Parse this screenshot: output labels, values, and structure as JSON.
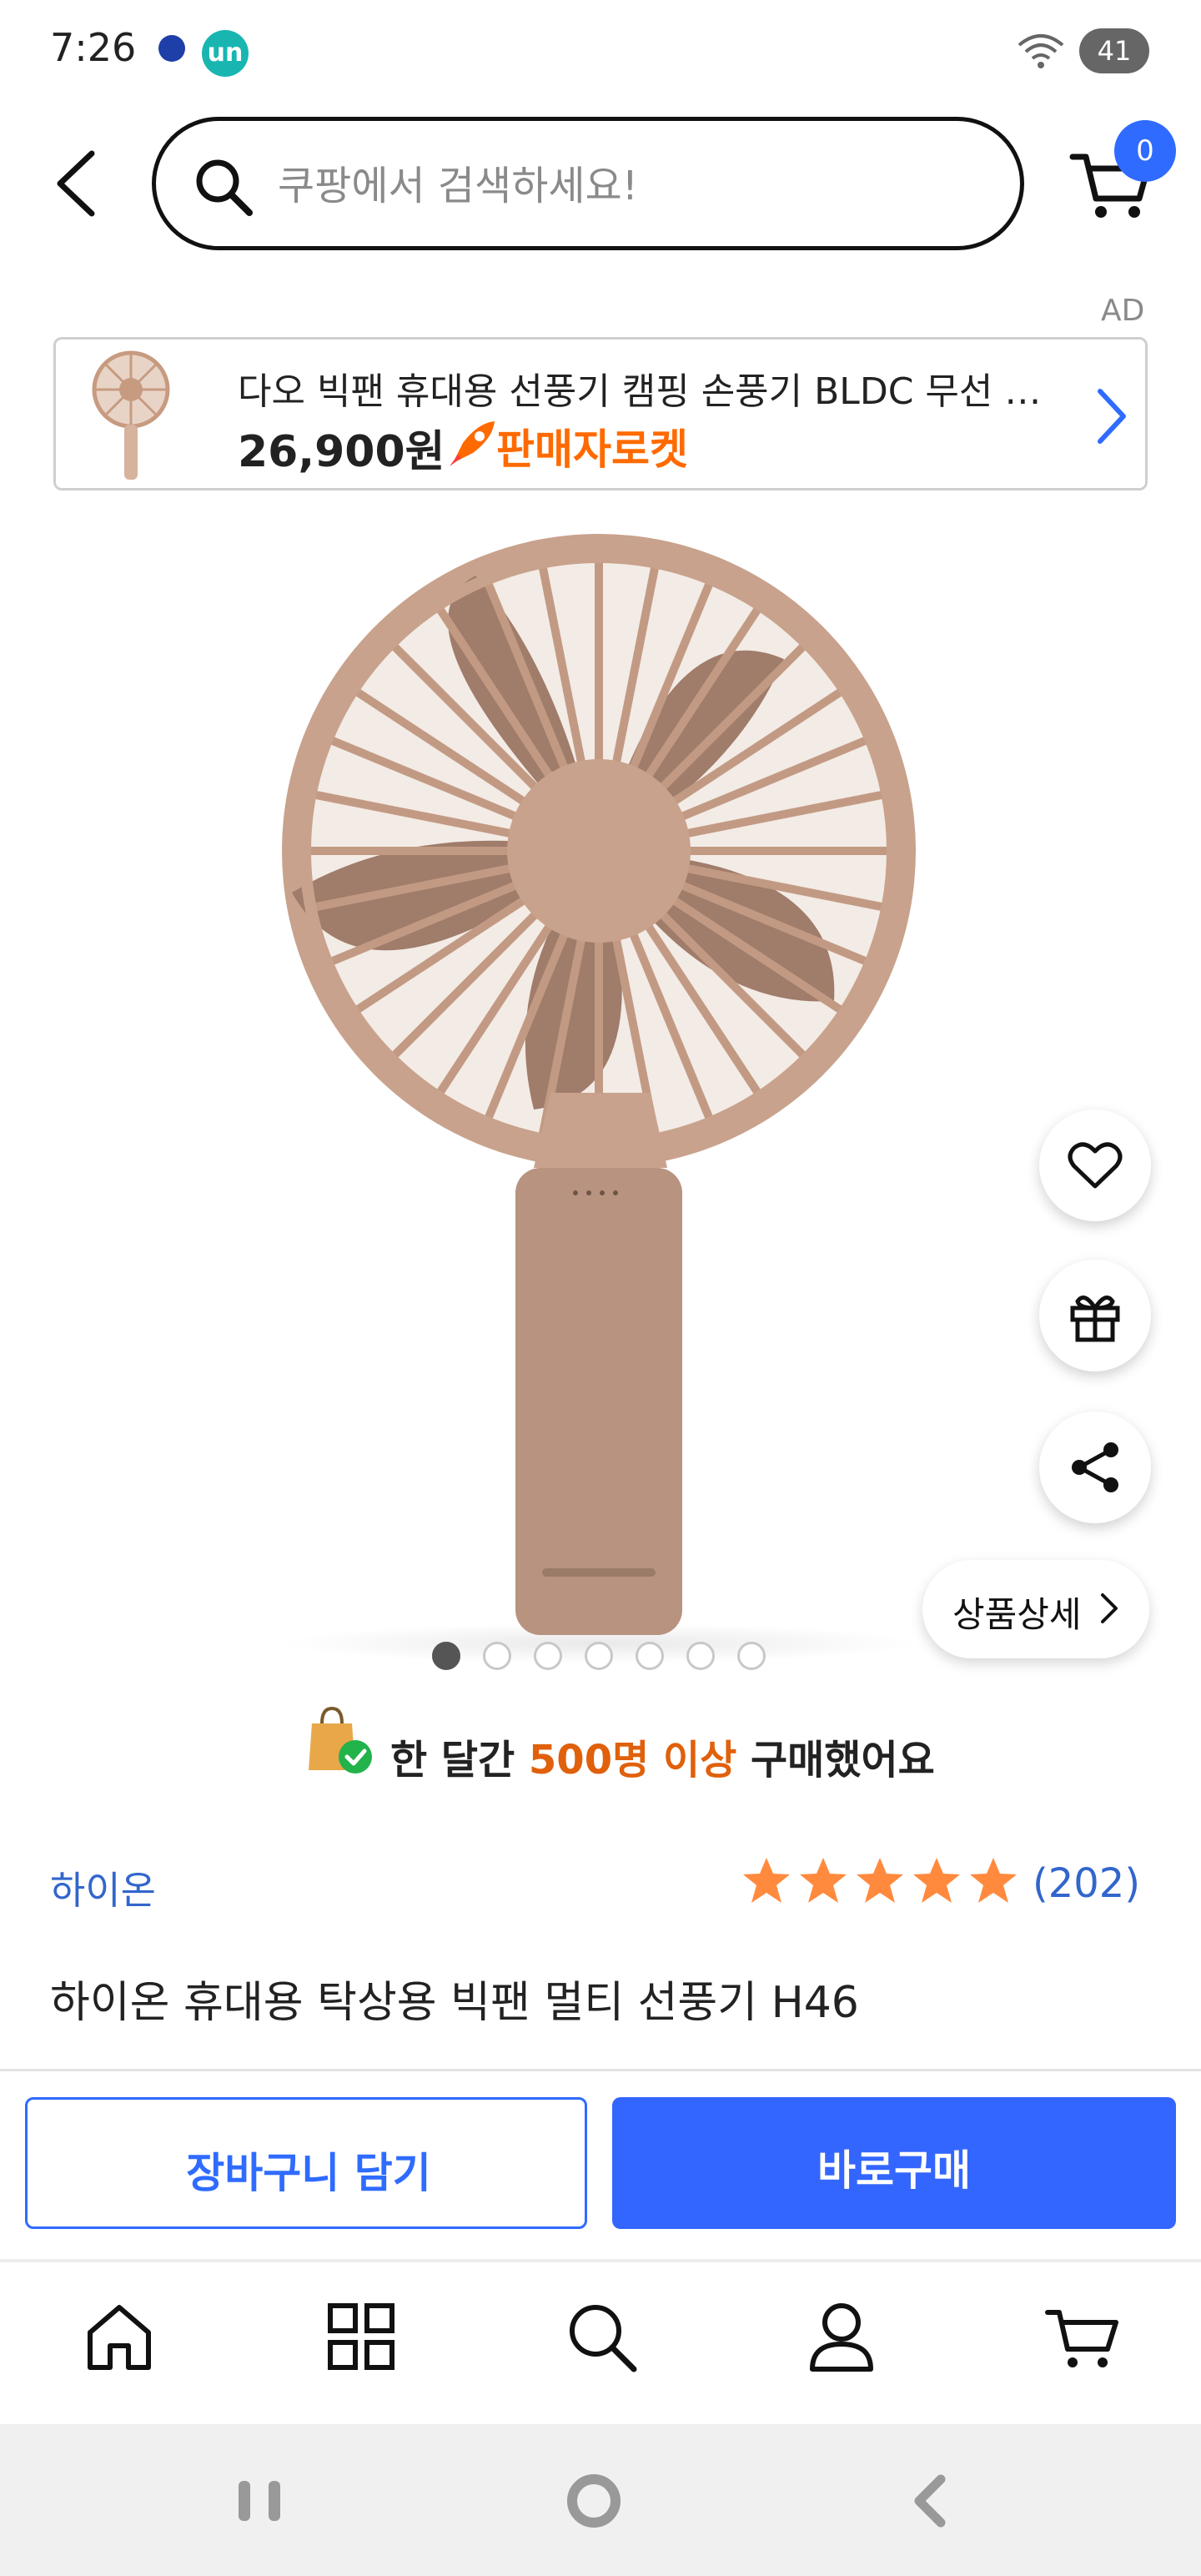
{
  "status_bar": {
    "time": "7:26",
    "app_badge": "un",
    "battery": "41"
  },
  "header": {
    "search_placeholder": "쿠팡에서 검색하세요!",
    "cart_count": "0"
  },
  "ad": {
    "label": "AD",
    "title": "다오 빅팬 휴대용 선풍기 캠핑 손풍기 BLDC 무선 핸디 선풍기",
    "price": "26,900원",
    "badge": "판매자로켓"
  },
  "product": {
    "image_count": 7,
    "active_image": 1,
    "detail_button": "상품상세",
    "purchase_prefix": "한 달간 ",
    "purchase_highlight": "500명 이상",
    "purchase_suffix": " 구매했어요",
    "brand": "하이온",
    "rating": 5,
    "review_count": "(202)",
    "title": "하이온 휴대용 탁상용 빅팬 멀티 선풍기 H46"
  },
  "actions": {
    "add_to_cart": "장바구니 담기",
    "buy_now": "바로구매"
  },
  "bottom_nav": {
    "items": [
      "home",
      "categories",
      "search",
      "my-account",
      "cart"
    ]
  },
  "colors": {
    "accent": "#3366ff",
    "link": "#3366cc",
    "highlight": "#e0600c",
    "star": "#ff8a3d"
  }
}
